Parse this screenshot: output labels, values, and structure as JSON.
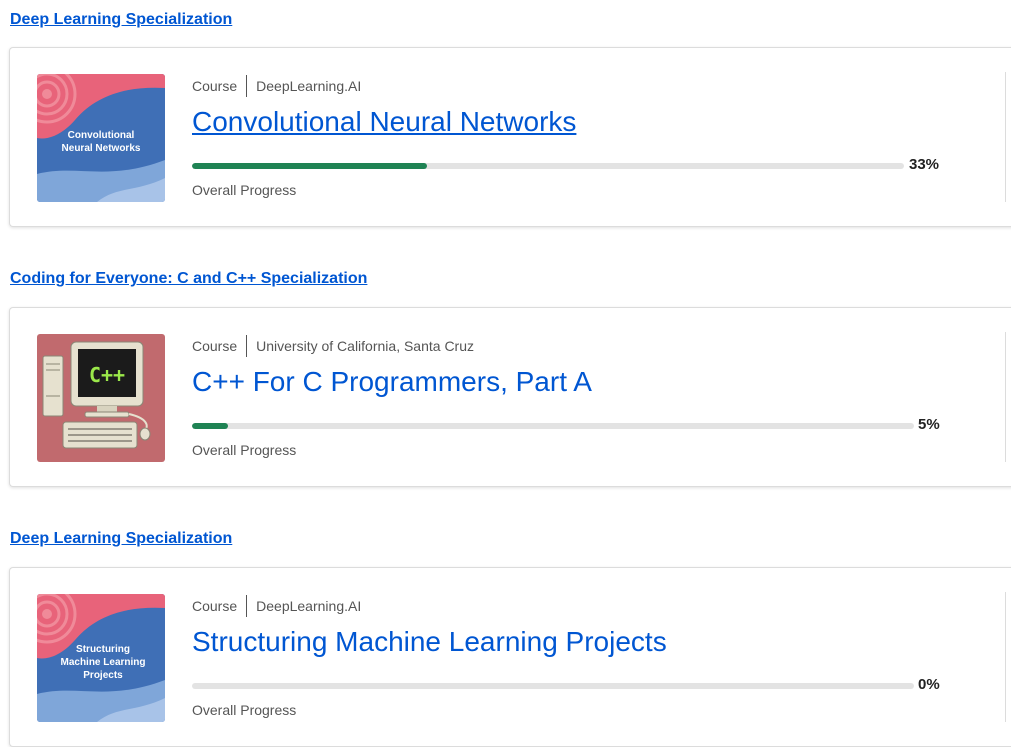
{
  "colors": {
    "link": "#0056d2",
    "progress_fill": "#1f8354",
    "progress_track": "#e3e3e3"
  },
  "items": [
    {
      "specialization": "Deep Learning Specialization",
      "type": "Course",
      "partner": "DeepLearning.AI",
      "title": "Convolutional Neural Networks",
      "thumbnail_text": [
        "Convolutional",
        "Neural Networks"
      ],
      "progress": 33,
      "progress_label": "33%",
      "progress_caption": "Overall Progress"
    },
    {
      "specialization": "Coding for Everyone: C and C++ Specialization",
      "type": "Course",
      "partner": "University of California, Santa Cruz",
      "title": "C++ For C Programmers, Part A",
      "thumbnail_text": [
        "C++"
      ],
      "progress": 5,
      "progress_label": "5%",
      "progress_caption": "Overall Progress"
    },
    {
      "specialization": "Deep Learning Specialization",
      "type": "Course",
      "partner": "DeepLearning.AI",
      "title": "Structuring Machine Learning Projects",
      "thumbnail_text": [
        "Structuring",
        "Machine Learning",
        "Projects"
      ],
      "progress": 0,
      "progress_label": "0%",
      "progress_caption": "Overall Progress"
    }
  ]
}
